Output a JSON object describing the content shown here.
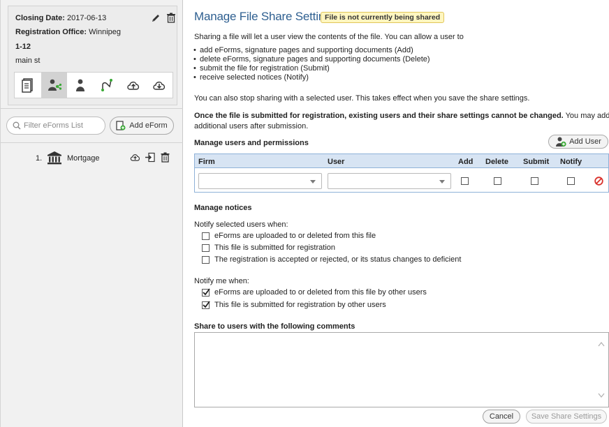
{
  "file_info": {
    "closing_label": "Closing Date:",
    "closing_value": "2017-06-13",
    "office_label": "Registration Office:",
    "office_value": "Winnipeg",
    "lot": "1-12",
    "street": "main st"
  },
  "toolbar": {
    "icons": [
      "document-icon",
      "share-users-icon",
      "person-icon",
      "routing-icon",
      "cloud-upload-icon",
      "cloud-download-icon"
    ],
    "active_index": 1
  },
  "filter": {
    "placeholder": "Filter eForms List"
  },
  "add_eform_label": "Add eForm",
  "eforms": [
    {
      "number": "1.",
      "name": "Mortgage"
    }
  ],
  "header": {
    "title": "Manage File Share Settings",
    "status_badge": "File is not currently being shared"
  },
  "intro": "Sharing a file will let a user view the contents of the file. You can allow a user to",
  "bullets": [
    "add eForms, signature pages and supporting documents (Add)",
    "delete eForms, signature pages and supporting documents (Delete)",
    "submit the file for registration (Submit)",
    "receive selected notices (Notify)"
  ],
  "stop_sharing": "You can also stop sharing with a selected user. This takes effect when you save the share settings.",
  "warning_bold": "Once the file is submitted for registration, existing users and their share settings cannot be changed.",
  "warning_rest": " You may add",
  "warning_line2": "additional users after submission.",
  "permissions": {
    "heading": "Manage users and permissions",
    "add_user_label": "Add User",
    "columns": [
      "Firm",
      "User",
      "Add",
      "Delete",
      "Submit",
      "Notify"
    ]
  },
  "notices": {
    "heading": "Manage notices",
    "selected_label": "Notify selected users when:",
    "selected_options": [
      {
        "label": "eForms are uploaded to or deleted from this file",
        "checked": false
      },
      {
        "label": "This file is submitted for registration",
        "checked": false
      },
      {
        "label": "The registration is accepted or rejected, or its status changes to deficient",
        "checked": false
      }
    ],
    "me_label": "Notify me when:",
    "me_options": [
      {
        "label": "eForms are uploaded to or deleted from this file by other users",
        "checked": true
      },
      {
        "label": "This file is submitted for registration by other users",
        "checked": true
      }
    ]
  },
  "comments_heading": "Share to users with the following comments",
  "buttons": {
    "cancel": "Cancel",
    "save": "Save Share Settings"
  },
  "colors": {
    "title": "#2e5f90",
    "table_header": "#d7e4f3",
    "badge_bg": "#fff6c0",
    "remove_icon": "#d9312b",
    "add_icon_green": "#39a935"
  }
}
